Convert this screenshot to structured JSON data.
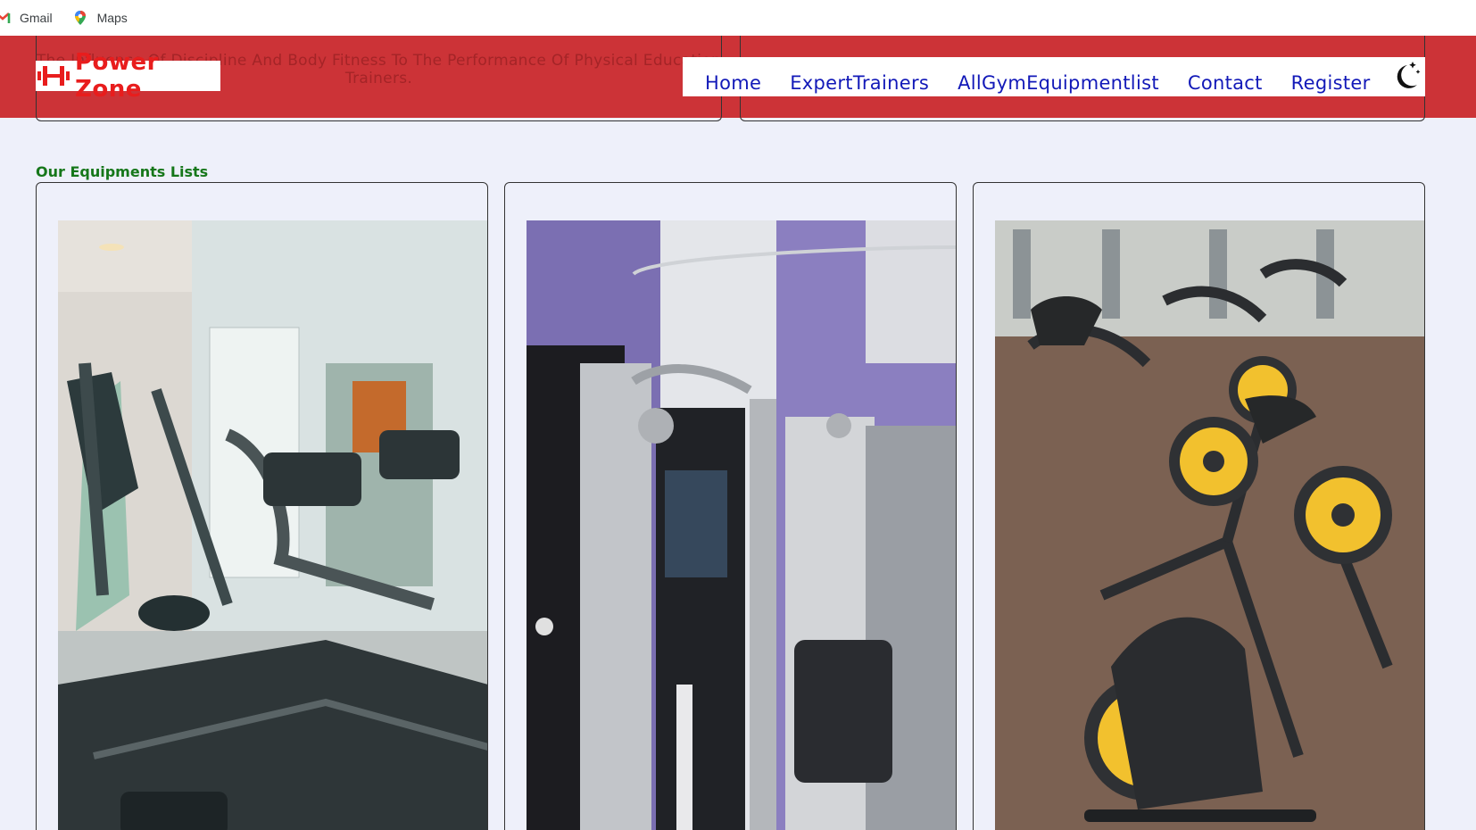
{
  "bookmarks": [
    {
      "label": "Gmail",
      "icon": "gmail-icon"
    },
    {
      "label": "Maps",
      "icon": "maps-pin-icon"
    }
  ],
  "background_card": {
    "text": "The Influence Of Discipline And Body Fitness To The Performance Of Physical Education Trainers."
  },
  "brand": {
    "name": "Power Zone",
    "logo_icon": "barbell-logo-icon",
    "color": "#e81d1d"
  },
  "nav": {
    "links": [
      "Home",
      "ExpertTrainers",
      "AllGymEquipmentlist",
      "Contact",
      "Register"
    ],
    "theme_toggle_icon": "moon-stars-icon"
  },
  "section": {
    "title": "Our Equipments Lists"
  },
  "equipment_cards": [
    {
      "image": "treadmills-photo"
    },
    {
      "image": "cable-machine-photo"
    },
    {
      "image": "spin-bikes-photo"
    }
  ],
  "colors": {
    "header_red": "#cc3337",
    "nav_blue": "#1219b8",
    "title_green": "#16771a",
    "page_bg": "#eef0fa"
  }
}
